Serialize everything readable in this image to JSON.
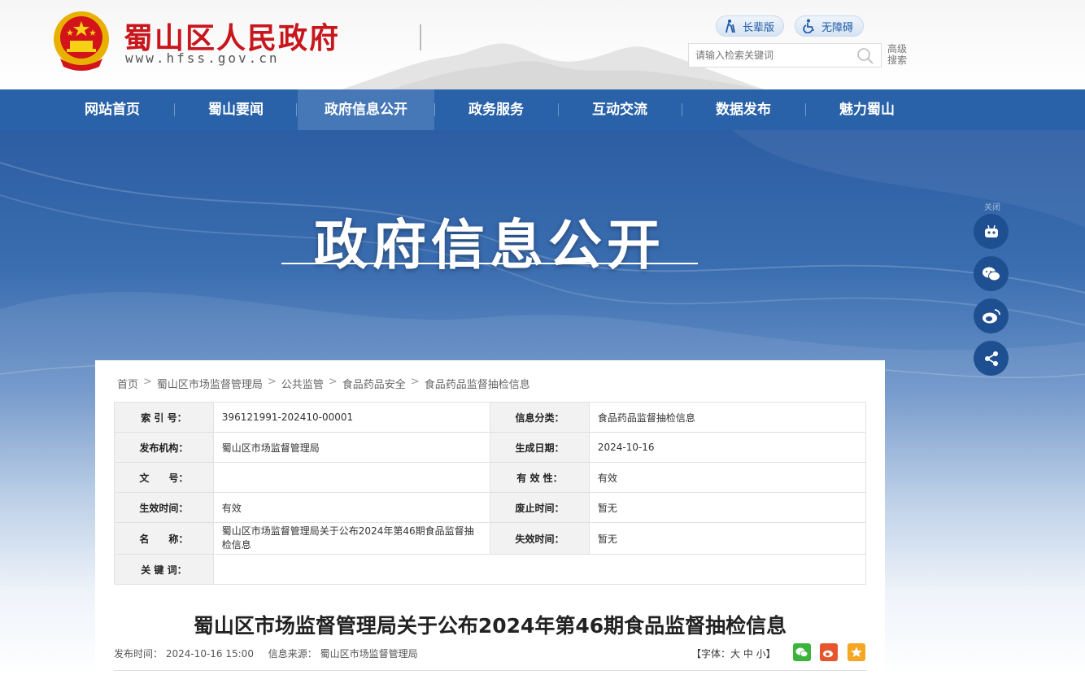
{
  "header": {
    "site_title": "蜀山区人民政府",
    "site_domain": "www.hfss.gov.cn",
    "elder_mode": "长辈版",
    "accessibility": "无障碍",
    "search_placeholder": "请输入检索关键词",
    "advanced_search": "高级搜索"
  },
  "nav": {
    "items": [
      "网站首页",
      "蜀山要闻",
      "政府信息公开",
      "政务服务",
      "互动交流",
      "数据发布",
      "魅力蜀山"
    ],
    "active": "政府信息公开"
  },
  "banner": {
    "title": "政府信息公开"
  },
  "side": {
    "label": "关闭",
    "buttons": [
      "robot-icon",
      "wechat-icon",
      "weibo-icon",
      "share-icon"
    ]
  },
  "breadcrumb": [
    "首页",
    "蜀山区市场监督管理局",
    "公共监管",
    "食品药品安全",
    "食品药品监督抽检信息"
  ],
  "meta": {
    "index_no_label": "索 引 号：",
    "index_no": "396121991-202410-00001",
    "category_label": "信息分类：",
    "category": "食品药品监督抽检信息",
    "publisher_label": "发布机构：",
    "publisher": "蜀山区市场监督管理局",
    "created_label": "生成日期：",
    "created": "2024-10-16",
    "doc_no_label": "文　　号：",
    "doc_no": "",
    "validity_label": "有 效 性：",
    "validity": "有效",
    "effective_label": "生效时间：",
    "effective": "有效",
    "repeal_label": "废止时间：",
    "repeal": "暂无",
    "name_label": "名　　称：",
    "name": "蜀山区市场监督管理局关于公布2024年第46期食品监督抽检信息",
    "expire_label": "失效时间：",
    "expire": "暂无",
    "keywords_label": "关 键 词：",
    "keywords": ""
  },
  "document": {
    "title": "蜀山区市场监督管理局关于公布2024年第46期食品监督抽检信息",
    "publish_time": "发布时间： 2024-10-16 15:00",
    "source": "信息来源： 蜀山区市场监督管理局",
    "font_size_text": "【字体：大  中  小】"
  },
  "colors": {
    "brand_red": "#c8161d",
    "nav_blue": "#2962a8",
    "nav_active": "#4678b8"
  }
}
